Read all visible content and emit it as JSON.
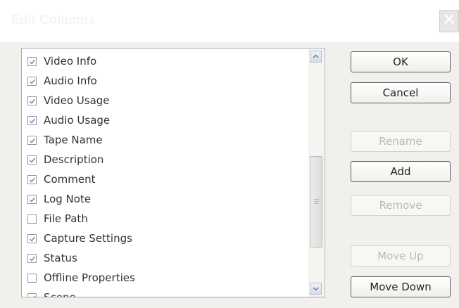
{
  "dialog": {
    "title": "Edit Columns",
    "close_glyph": "✕"
  },
  "columns": [
    {
      "label": "Video Info",
      "checked": true
    },
    {
      "label": "Audio Info",
      "checked": true
    },
    {
      "label": "Video Usage",
      "checked": true
    },
    {
      "label": "Audio Usage",
      "checked": true
    },
    {
      "label": "Tape Name",
      "checked": true
    },
    {
      "label": "Description",
      "checked": true
    },
    {
      "label": "Comment",
      "checked": true
    },
    {
      "label": "Log Note",
      "checked": true
    },
    {
      "label": "File Path",
      "checked": false
    },
    {
      "label": "Capture Settings",
      "checked": true
    },
    {
      "label": "Status",
      "checked": true
    },
    {
      "label": "Offline Properties",
      "checked": false
    },
    {
      "label": "Scene",
      "checked": true
    }
  ],
  "buttons": {
    "ok": "OK",
    "cancel": "Cancel",
    "rename": "Rename",
    "add": "Add",
    "remove": "Remove",
    "move_up": "Move Up",
    "move_down": "Move Down"
  },
  "colors": {
    "checkmark": "#7d8aa0",
    "disabled_text": "#b9b9b5"
  }
}
